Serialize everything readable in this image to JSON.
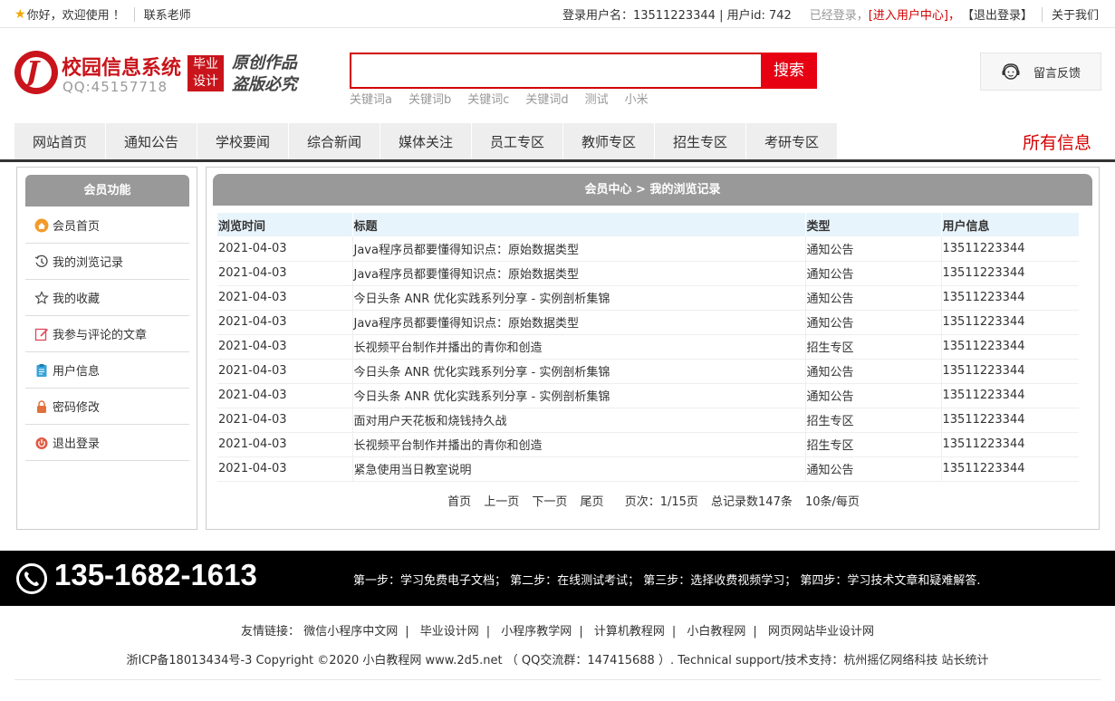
{
  "topbar": {
    "welcome": "你好，欢迎使用 ！",
    "contact": "联系老师",
    "login_user": "登录用户名：13511223344 | 用户id: 742",
    "logged_in": "已经登录，",
    "user_center": "[进入用户中心]",
    "comma": "，",
    "logout": "【退出登录】",
    "about": "关于我们"
  },
  "header": {
    "logo_title": "校园信息系统",
    "logo_qq": "QQ:45157718",
    "badge_line1": "毕业",
    "badge_line2": "设计",
    "slogan_line1": "原创作品",
    "slogan_line2": "盗版必究",
    "search_placeholder": "",
    "search_button": "搜索",
    "keywords": [
      "关键词a",
      "关键词b",
      "关键词c",
      "关键词d",
      "测试",
      "小米"
    ],
    "feedback": "留言反馈"
  },
  "nav": {
    "items": [
      "网站首页",
      "通知公告",
      "学校要闻",
      "综合新闻",
      "媒体关注",
      "员工专区",
      "教师专区",
      "招生专区",
      "考研专区"
    ],
    "all_info": "所有信息"
  },
  "sidebar": {
    "title": "会员功能",
    "items": [
      {
        "label": "会员首页",
        "icon": "home-icon"
      },
      {
        "label": "我的浏览记录",
        "icon": "history-icon"
      },
      {
        "label": "我的收藏",
        "icon": "star-icon"
      },
      {
        "label": "我参与评论的文章",
        "icon": "edit-icon"
      },
      {
        "label": "用户信息",
        "icon": "clipboard-icon"
      },
      {
        "label": "密码修改",
        "icon": "lock-icon"
      },
      {
        "label": "退出登录",
        "icon": "power-icon"
      }
    ]
  },
  "main": {
    "title": "会员中心 > 我的浏览记录",
    "columns": [
      "浏览时间",
      "标题",
      "类型",
      "用户信息"
    ],
    "rows": [
      [
        "2021-04-03",
        "Java程序员都要懂得知识点：原始数据类型",
        "通知公告",
        "13511223344"
      ],
      [
        "2021-04-03",
        "Java程序员都要懂得知识点：原始数据类型",
        "通知公告",
        "13511223344"
      ],
      [
        "2021-04-03",
        "今日头条 ANR 优化实践系列分享 - 实例剖析集锦",
        "通知公告",
        "13511223344"
      ],
      [
        "2021-04-03",
        "Java程序员都要懂得知识点：原始数据类型",
        "通知公告",
        "13511223344"
      ],
      [
        "2021-04-03",
        "长视频平台制作并播出的青你和创造",
        "招生专区",
        "13511223344"
      ],
      [
        "2021-04-03",
        "今日头条 ANR 优化实践系列分享 - 实例剖析集锦",
        "通知公告",
        "13511223344"
      ],
      [
        "2021-04-03",
        "今日头条 ANR 优化实践系列分享 - 实例剖析集锦",
        "通知公告",
        "13511223344"
      ],
      [
        "2021-04-03",
        "面对用户天花板和烧钱持久战",
        "招生专区",
        "13511223344"
      ],
      [
        "2021-04-03",
        "长视频平台制作并播出的青你和创造",
        "招生专区",
        "13511223344"
      ],
      [
        "2021-04-03",
        "紧急使用当日教室说明",
        "通知公告",
        "13511223344"
      ]
    ],
    "pager": {
      "first": "首页",
      "prev": "上一页",
      "next": "下一页",
      "last": "尾页",
      "page_info": "页次：1/15页",
      "total": "总记录数147条",
      "per_page": "10条/每页"
    }
  },
  "footer": {
    "phone": "135-1682-1613",
    "steps": "第一步：学习免费电子文档；  第二步：在线测试考试；  第三步：选择收费视频学习；  第四步：学习技术文章和疑难解答.",
    "links_label": "友情链接：",
    "links": [
      "微信小程序中文网",
      "毕业设计网",
      "小程序教学网",
      "计算机教程网",
      "小白教程网",
      "网页网站毕业设计网"
    ],
    "copyright": "浙ICP备18013434号-3 Copyright ©2020 小白教程网 www.2d5.net （ QQ交流群：147415688 ）. Technical support/技术支持：杭州摇亿网络科技 站长统计"
  },
  "colors": {
    "accent_red": "#d40000",
    "search_button": "#e60012",
    "panel_header": "#999999",
    "table_header": "#e8f4fb",
    "footer_bg": "#000000"
  }
}
